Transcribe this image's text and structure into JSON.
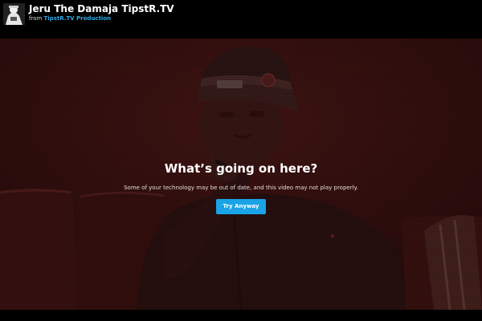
{
  "header": {
    "title": "Jeru The Damaja TipstR.TV",
    "byline_prefix": "from",
    "owner": "TipstR.TV Production",
    "avatar_icon": "user-avatar"
  },
  "message": {
    "title": "What’s going on here?",
    "body": "Some of your technology may be out of date, and this video may not play properly.",
    "button_label": "Try Anyway"
  },
  "colors": {
    "background": "#000000",
    "link": "#2fa9e6",
    "button": "#1aa3e6",
    "frame_tint": "#2a0f0e"
  }
}
